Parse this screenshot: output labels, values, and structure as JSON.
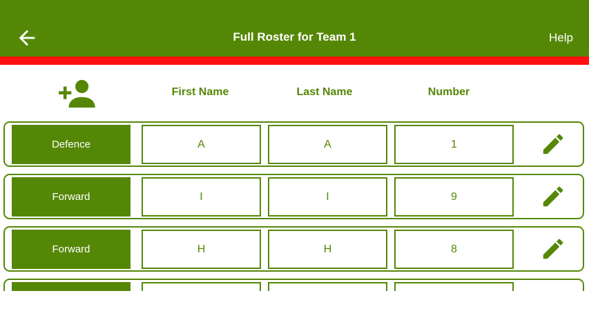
{
  "appbar": {
    "title": "Full Roster for Team 1",
    "help_label": "Help",
    "back_icon": "arrow-left-icon"
  },
  "colors": {
    "primary": "#558707",
    "accent_line": "#ff0f0f",
    "background": "#ffffff"
  },
  "header": {
    "add_icon": "add-person-icon",
    "first_name": "First Name",
    "last_name": "Last Name",
    "number": "Number"
  },
  "rows": [
    {
      "position": "Defence",
      "first": "A",
      "last": "A",
      "number": "1"
    },
    {
      "position": "Forward",
      "first": "I",
      "last": "I",
      "number": "9"
    },
    {
      "position": "Forward",
      "first": "H",
      "last": "H",
      "number": "8"
    },
    {
      "position": "",
      "first": "",
      "last": "",
      "number": ""
    }
  ]
}
